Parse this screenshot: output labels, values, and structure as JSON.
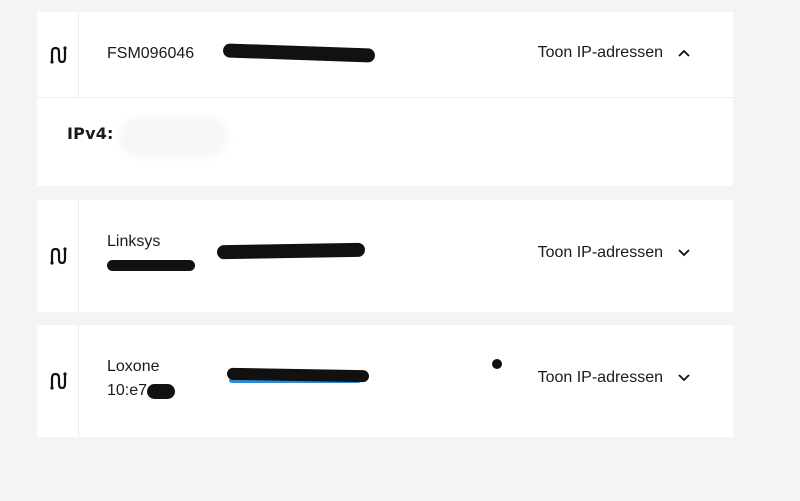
{
  "devices": [
    {
      "name_line1": "FSM096046",
      "name_line2": "",
      "toggle_label": "Toon IP-adressen",
      "expanded": true,
      "ipv4_label": "IPv4:"
    },
    {
      "name_line1": "Linksys",
      "name_line2": "",
      "toggle_label": "Toon IP-adressen",
      "expanded": false
    },
    {
      "name_line1": "Loxone",
      "name_line2": "10:e7",
      "toggle_label": "Toon IP-adressen",
      "expanded": false
    }
  ],
  "icons": {
    "device": "network-device-icon",
    "chevron_up": "chevron-up-icon",
    "chevron_down": "chevron-down-icon"
  },
  "colors": {
    "background": "#f4f4f4",
    "card": "#ffffff",
    "text": "#1a1a1a",
    "redaction": "#111111",
    "highlight": "#2a8ad6"
  }
}
